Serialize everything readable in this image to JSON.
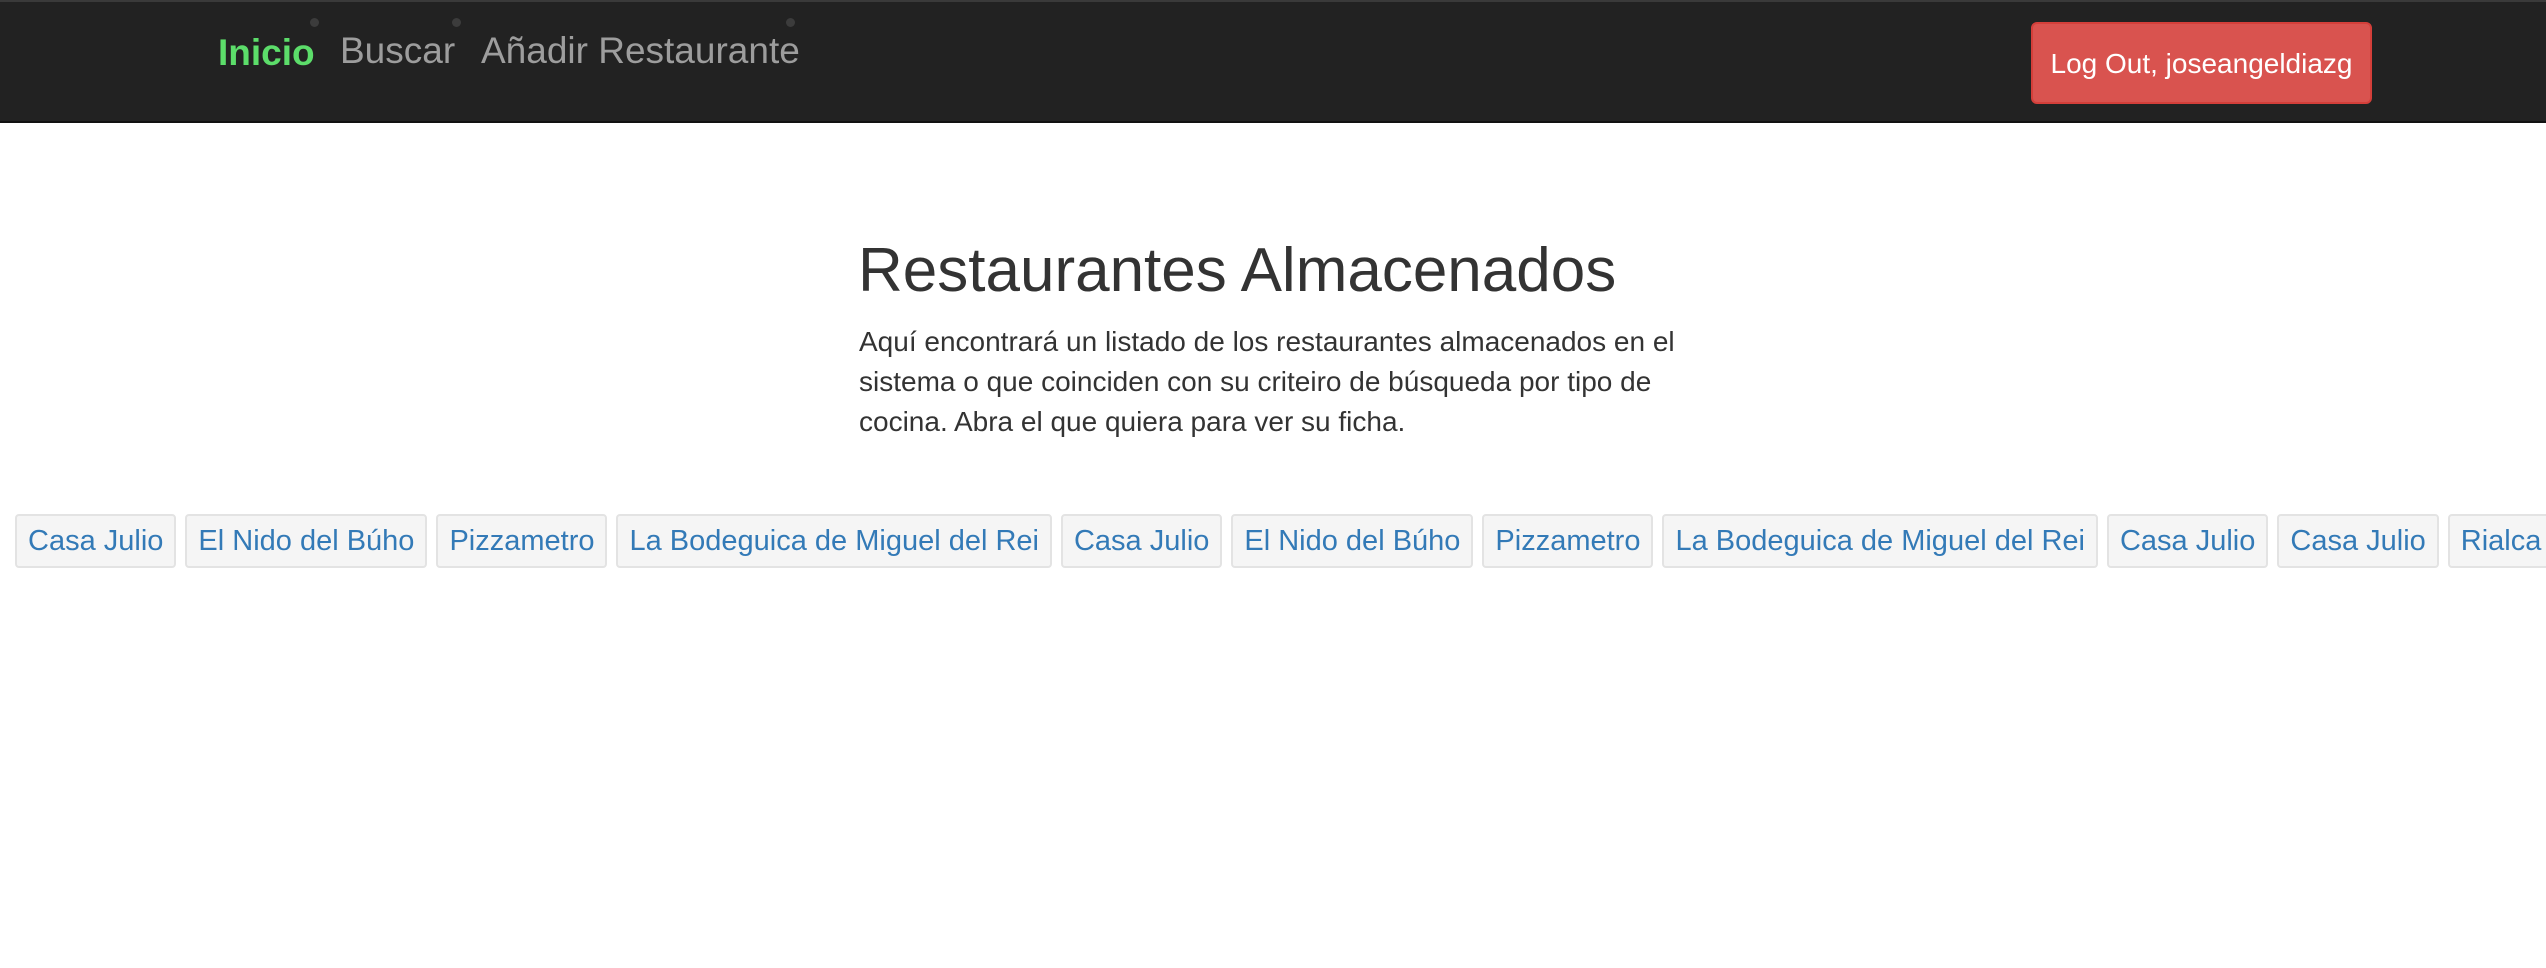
{
  "nav": {
    "items": [
      {
        "label": "Inicio",
        "active": true
      },
      {
        "label": "Buscar",
        "active": false
      },
      {
        "label": "Añadir Restaurante",
        "active": false
      }
    ],
    "logout_label": "Log Out, joseangeldiazg"
  },
  "main": {
    "title": "Restaurantes Almacenados",
    "description": "Aquí encontrará un listado de los restaurantes almacenados en el sistema o que coinciden con su criteiro de búsqueda por tipo de cocina. Abra el que quiera para ver su ficha."
  },
  "restaurants": [
    "Casa Julio",
    "El Nido del Búho",
    "Pizzametro",
    "La Bodeguica de Miguel del Rei",
    "Casa Julio",
    "El Nido del Búho",
    "Pizzametro",
    "La Bodeguica de Miguel del Rei",
    "Casa Julio",
    "Casa Julio",
    "Rialca"
  ],
  "colors": {
    "navbar_background": "#222222",
    "active_nav": "#5cdd6a",
    "inactive_nav": "#9d9d9d",
    "logout_button": "#d9534f",
    "link": "#337ab7"
  }
}
